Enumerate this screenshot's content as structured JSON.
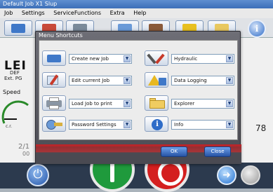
{
  "window": {
    "title": "Default Job X1 Slup"
  },
  "menubar": {
    "items": [
      "Job",
      "Settings",
      "ServiceFunctions",
      "Extra",
      "Help"
    ]
  },
  "background": {
    "brand_partial": "LEI",
    "def_text": "DEF",
    "ext_text": "Ext. PG",
    "speed_label": "Speed",
    "gauge_text": "c.r.",
    "counter_value": "78",
    "job_counter": "2/1",
    "job_sub": "00"
  },
  "dialog": {
    "title": "Menu Shortcuts",
    "ok_label": "OK",
    "close_label": "Close",
    "shortcuts_left": [
      {
        "icon": "new-job-icon",
        "label": "Create new Job"
      },
      {
        "icon": "edit-job-icon",
        "label": "Edit current Job"
      },
      {
        "icon": "print-icon",
        "label": "Load Job to print"
      },
      {
        "icon": "password-icon",
        "label": "Password Settings"
      }
    ],
    "shortcuts_right": [
      {
        "icon": "hydraulic-icon",
        "label": "Hydraulic"
      },
      {
        "icon": "data-logging-icon",
        "label": "Data Logging"
      },
      {
        "icon": "explorer-icon",
        "label": "Explorer"
      },
      {
        "icon": "info-icon",
        "label": "Info"
      }
    ]
  },
  "colors": {
    "accent": "#2e6cc8",
    "start": "#1f9a3c",
    "stop": "#d41f1f",
    "dialog_bar": "#b8262b"
  }
}
